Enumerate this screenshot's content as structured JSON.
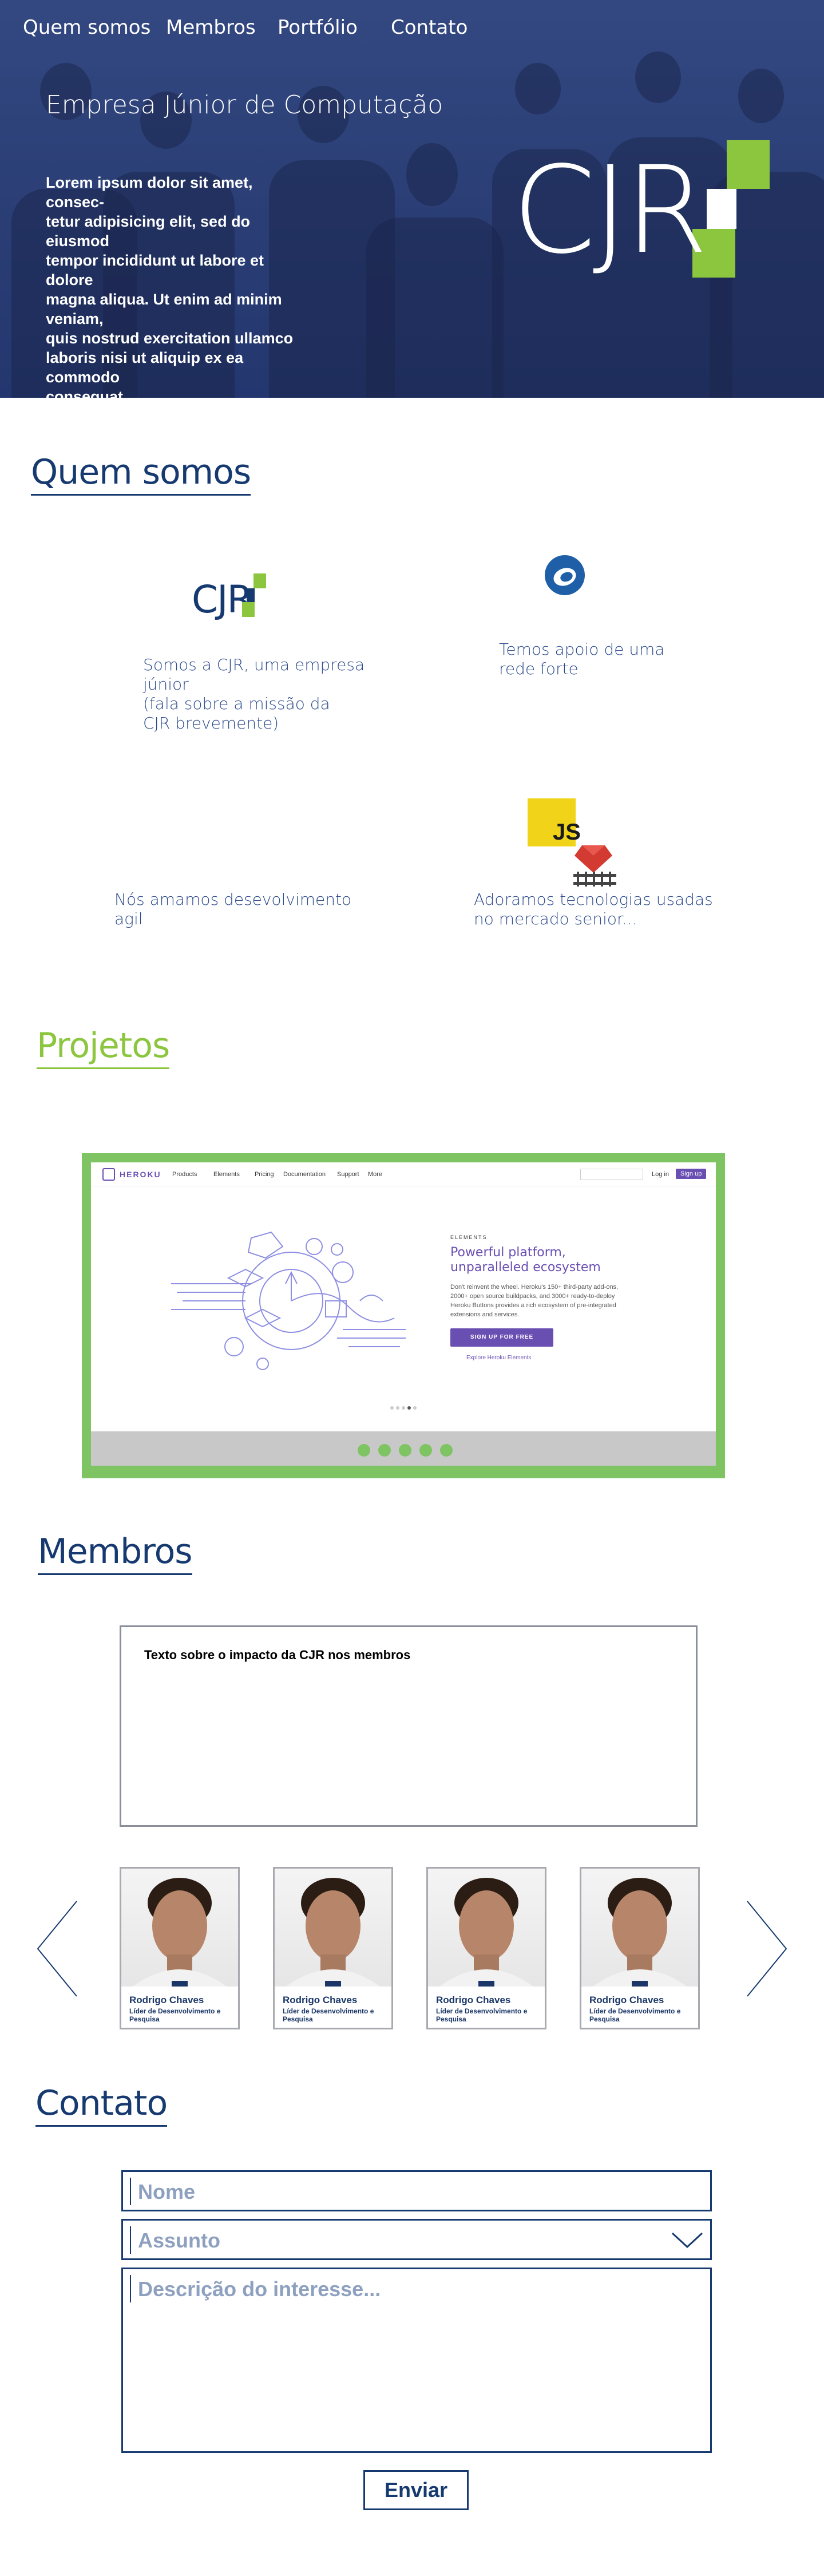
{
  "nav": {
    "items": [
      "Quem somos",
      "Membros",
      "Portfólio",
      "Contato"
    ]
  },
  "hero": {
    "title": "Empresa Júnior de Computação",
    "text": "Lorem ipsum dolor sit amet, consec-\ntetur adipisicing elit, sed do eiusmod\ntempor incididunt ut labore et dolore\nmagna aliqua. Ut enim ad minim\nveniam,\nquis nostrud exercitation ullamco\nlaboris nisi ut aliquip ex ea commodo\nconsequat.",
    "logo_text": "CJR"
  },
  "quem_somos": {
    "title": "Quem somos",
    "features": [
      {
        "icon": "cjr-logo-icon",
        "logo_text": "CJR",
        "text": "Somos a CJR, uma empresa\n júnior\n(fala sobre a missão da\nCJR brevemente)"
      },
      {
        "icon": "network-icon",
        "text": "Temos apoio de uma\nrede forte"
      },
      {
        "icon": "code-icon",
        "text": "Nós amamos desevolvimento\nagil"
      },
      {
        "icon": "js-rails-icon",
        "js_label": "JS",
        "text": "Adoramos tecnologias usadas\nno mercado senior..."
      }
    ]
  },
  "projetos": {
    "title": "Projetos",
    "preview": {
      "brand": "HEROKU",
      "menu": [
        "Products",
        "Elements",
        "Pricing",
        "Documentation",
        "Support",
        "More"
      ],
      "login": "Log in",
      "signup": "Sign up",
      "eyebrow": "ELEMENTS",
      "headline": "Powerful platform, unparalleled ecosystem",
      "body": "Don't reinvent the wheel. Heroku's 150+ third-party add-ons, 2000+ open source buildpacks, and 3000+ ready-to-deploy Heroku Buttons provides a rich ecosystem of pre-integrated extensions and services.",
      "cta": "SIGN UP FOR FREE",
      "link": "Explore Heroku Elements"
    },
    "slides": 5
  },
  "membros": {
    "title": "Membros",
    "box_text": "Texto sobre o impacto da CJR nos membros",
    "members": [
      {
        "name": "Rodrigo Chaves",
        "role": "Líder de Desenvolvimento e Pesquisa"
      },
      {
        "name": "Rodrigo Chaves",
        "role": "Líder de Desenvolvimento e Pesquisa"
      },
      {
        "name": "Rodrigo Chaves",
        "role": "Líder de Desenvolvimento e Pesquisa"
      },
      {
        "name": "Rodrigo Chaves",
        "role": "Líder de Desenvolvimento e Pesquisa"
      }
    ]
  },
  "contato": {
    "title": "Contato",
    "name_placeholder": "Nome",
    "subject_placeholder": "Assunto",
    "description_placeholder": "Descrição do interesse...",
    "send_label": "Enviar"
  },
  "colors": {
    "navy": "#163a70",
    "green": "#8cc63e",
    "hero_blue": "#2c3f74"
  }
}
